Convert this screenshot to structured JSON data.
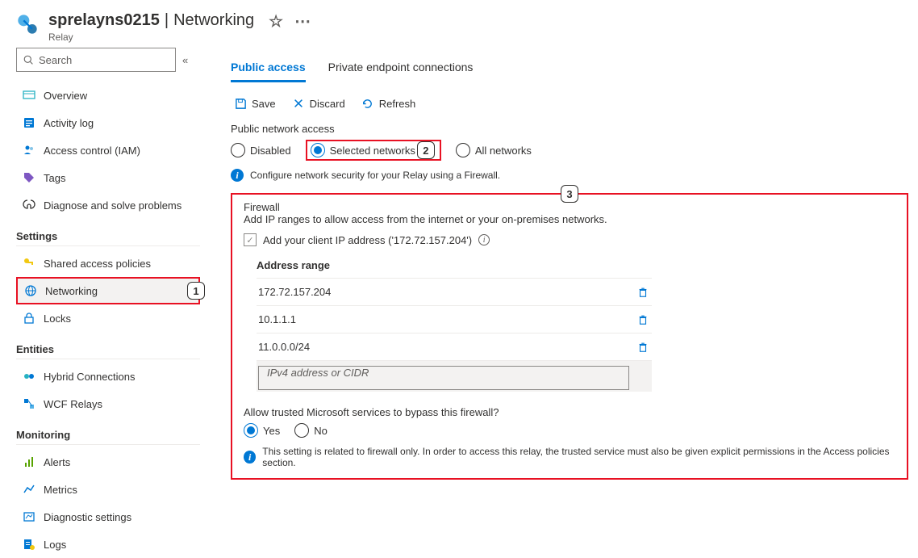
{
  "header": {
    "resource_name": "sprelayns0215",
    "blade_title": "Networking",
    "separator": " | ",
    "resource_type": "Relay"
  },
  "sidebar": {
    "search_placeholder": "Search",
    "items_top": [
      {
        "icon": "overview",
        "label": "Overview"
      },
      {
        "icon": "activity",
        "label": "Activity log"
      },
      {
        "icon": "iam",
        "label": "Access control (IAM)"
      },
      {
        "icon": "tags",
        "label": "Tags"
      },
      {
        "icon": "diagnose",
        "label": "Diagnose and solve problems"
      }
    ],
    "section_settings": "Settings",
    "items_settings": [
      {
        "icon": "key",
        "label": "Shared access policies"
      },
      {
        "icon": "network",
        "label": "Networking",
        "active": true,
        "callout": "1"
      },
      {
        "icon": "lock",
        "label": "Locks"
      }
    ],
    "section_entities": "Entities",
    "items_entities": [
      {
        "icon": "hybrid",
        "label": "Hybrid Connections"
      },
      {
        "icon": "wcf",
        "label": "WCF Relays"
      }
    ],
    "section_monitoring": "Monitoring",
    "items_monitoring": [
      {
        "icon": "alerts",
        "label": "Alerts"
      },
      {
        "icon": "metrics",
        "label": "Metrics"
      },
      {
        "icon": "diagset",
        "label": "Diagnostic settings"
      },
      {
        "icon": "logs",
        "label": "Logs"
      }
    ]
  },
  "main": {
    "tabs": [
      {
        "label": "Public access",
        "active": true
      },
      {
        "label": "Private endpoint connections"
      }
    ],
    "toolbar": {
      "save": "Save",
      "discard": "Discard",
      "refresh": "Refresh"
    },
    "public_access": {
      "label": "Public network access",
      "options": [
        {
          "value": "disabled",
          "label": "Disabled"
        },
        {
          "value": "selected",
          "label": "Selected networks",
          "selected": true,
          "callout": "2"
        },
        {
          "value": "all",
          "label": "All networks"
        }
      ],
      "info": "Configure network security for your Relay using a Firewall."
    },
    "firewall": {
      "callout": "3",
      "title": "Firewall",
      "desc": "Add IP ranges to allow access from the internet or your on-premises networks.",
      "add_client_ip_label": "Add your client IP address ('172.72.157.204')",
      "table_header": "Address range",
      "rows": [
        "172.72.157.204",
        "10.1.1.1",
        "11.0.0.0/24"
      ],
      "input_placeholder": "IPv4 address or CIDR"
    },
    "bypass": {
      "label": "Allow trusted Microsoft services to bypass this firewall?",
      "yes": "Yes",
      "no": "No",
      "info": "This setting is related to firewall only. In order to access this relay, the trusted service must also be given explicit permissions in the Access policies section."
    }
  }
}
